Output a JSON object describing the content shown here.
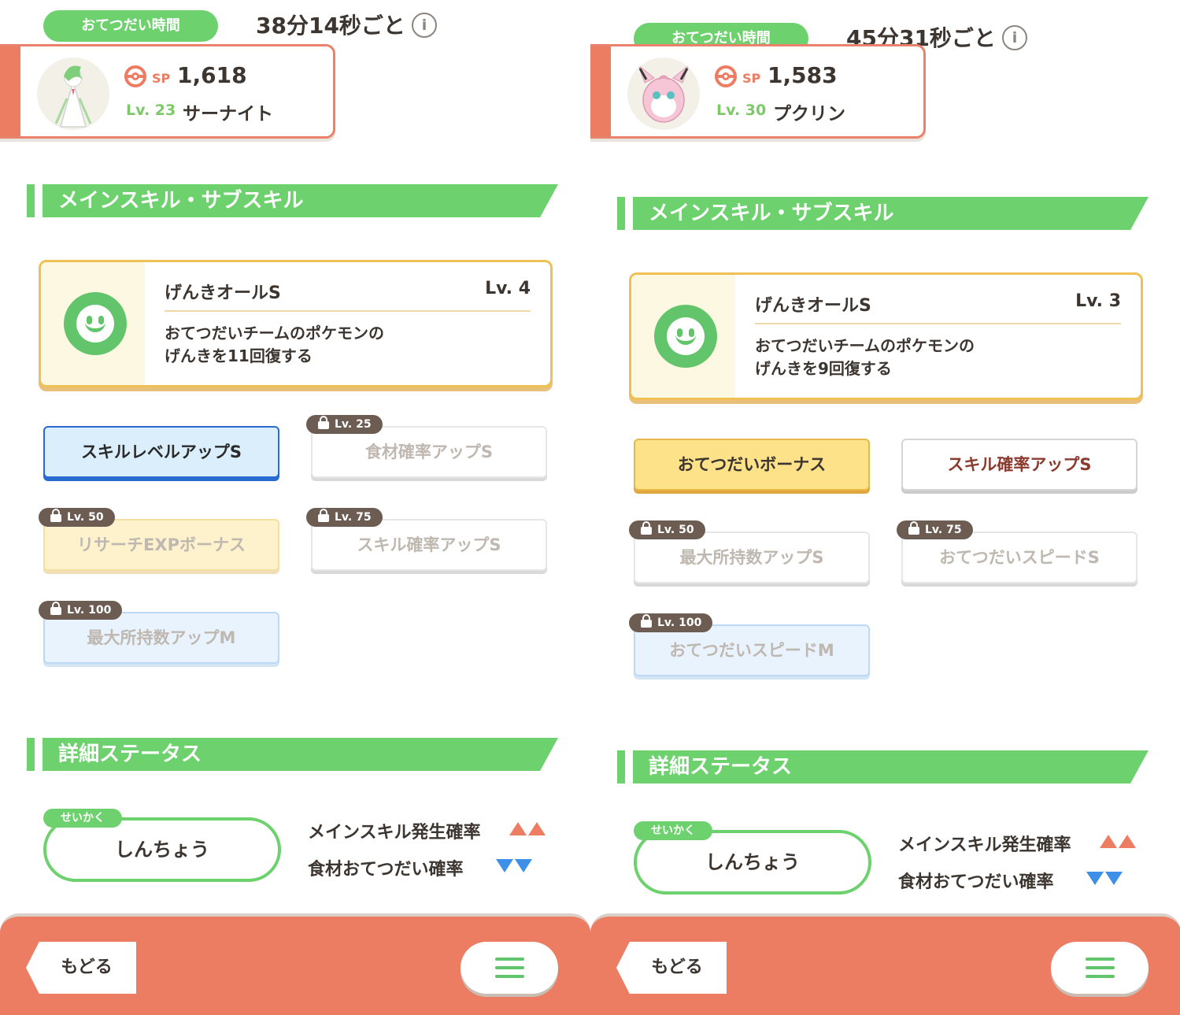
{
  "panels": [
    {
      "help_label": "おてつだい時間",
      "help_time": "38分14秒ごと",
      "info_icon": "i",
      "sp_label": "SP",
      "sp_value": "1,618",
      "level": "Lv. 23",
      "pokemon_name": "サーナイト",
      "section_skills": "メインスキル・サブスキル",
      "main_skill": {
        "name": "げんきオールS",
        "level": "Lv. 4",
        "desc_line1": "おてつだいチームのポケモンの",
        "desc_line2": "げんきを11回復する"
      },
      "subskills": [
        {
          "label": "スキルレベルアップS",
          "lock": ""
        },
        {
          "label": "食材確率アップS",
          "lock": "Lv. 25"
        },
        {
          "label": "リサーチEXPボーナス",
          "lock": "Lv. 50"
        },
        {
          "label": "スキル確率アップS",
          "lock": "Lv. 75"
        },
        {
          "label": "最大所持数アップM",
          "lock": "Lv. 100"
        }
      ],
      "section_status": "詳細ステータス",
      "nature_tag": "せいかく",
      "nature": "しんちょう",
      "stat_up": "メインスキル発生確率",
      "stat_down": "食材おてつだい確率",
      "back_label": "もどる"
    },
    {
      "help_label": "おてつだい時間",
      "help_time": "45分31秒ごと",
      "info_icon": "i",
      "sp_label": "SP",
      "sp_value": "1,583",
      "level": "Lv. 30",
      "pokemon_name": "プクリン",
      "section_skills": "メインスキル・サブスキル",
      "main_skill": {
        "name": "げんきオールS",
        "level": "Lv. 3",
        "desc_line1": "おてつだいチームのポケモンの",
        "desc_line2": "げんきを9回復する"
      },
      "subskills": [
        {
          "label": "おてつだいボーナス",
          "lock": ""
        },
        {
          "label": "スキル確率アップS",
          "lock": ""
        },
        {
          "label": "最大所持数アップS",
          "lock": "Lv. 50"
        },
        {
          "label": "おてつだいスピードS",
          "lock": "Lv. 75"
        },
        {
          "label": "おてつだいスピードM",
          "lock": "Lv. 100"
        }
      ],
      "section_status": "詳細ステータス",
      "nature_tag": "せいかく",
      "nature": "しんちょう",
      "stat_up": "メインスキル発生確率",
      "stat_down": "食材おてつだい確率",
      "back_label": "もどる"
    }
  ],
  "colors": {
    "accent_green": "#6dd16d",
    "accent_orange": "#ec7c62",
    "stat_up": "#ec7c62",
    "stat_down": "#3d8fe8"
  },
  "icons": {
    "sp": "sp-ball-icon",
    "skill": "smile-icon",
    "lock": "lock-icon",
    "info": "info-icon",
    "menu": "hamburger-menu-icon"
  }
}
